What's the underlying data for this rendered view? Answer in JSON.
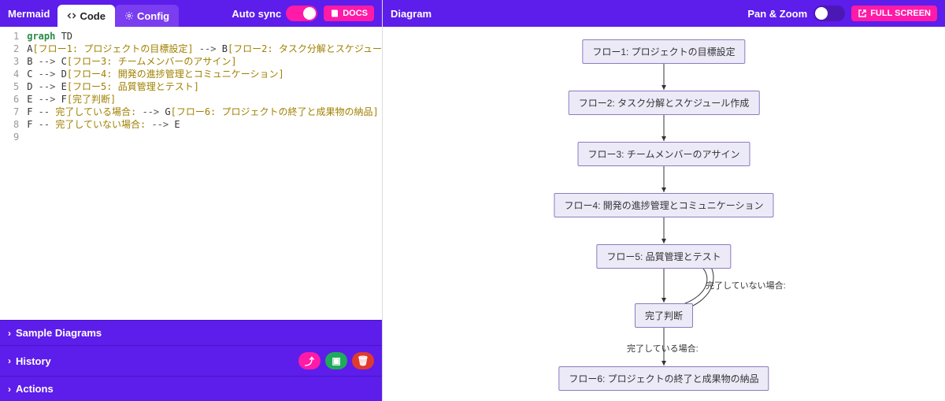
{
  "left": {
    "brand": "Mermaid",
    "tabs": {
      "code": "Code",
      "config": "Config"
    },
    "autosync_label": "Auto sync",
    "docs_label": "DOCS",
    "code": {
      "lines": [
        "1",
        "2",
        "3",
        "4",
        "5",
        "6",
        "7",
        "8",
        "9"
      ],
      "l1_kw": "graph",
      "l1_dir": "TD",
      "l2_a": "A",
      "l2_astr": "[フロー1: プロジェクトの目標設定]",
      "l2_arrow": " --> ",
      "l2_b": "B",
      "l2_bstr": "[フロー2: タスク分解とスケジュー",
      "l3_a": "B",
      "l3_arrow": " --> ",
      "l3_b": "C",
      "l3_bstr": "[フロー3: チームメンバーのアサイン]",
      "l4_a": "C",
      "l4_arrow": " --> ",
      "l4_b": "D",
      "l4_bstr": "[フロー4: 開発の進捗管理とコミュニケーション]",
      "l5_a": "D",
      "l5_arrow": " --> ",
      "l5_b": "E",
      "l5_bstr": "[フロー5: 品質管理とテスト]",
      "l6_a": "E",
      "l6_arrow": " --> ",
      "l6_b": "F",
      "l6_bstr": "[完了判断]",
      "l7_a": "F",
      "l7_dash": " -- ",
      "l7_lbl": "完了している場合:",
      "l7_arrow": " --> ",
      "l7_b": "G",
      "l7_bstr": "[フロー6: プロジェクトの終了と成果物の納品]",
      "l8_a": "F",
      "l8_dash": " -- ",
      "l8_lbl": "完了していない場合:",
      "l8_arrow": " --> ",
      "l8_b": "E"
    },
    "panels": {
      "sample": "Sample Diagrams",
      "history": "History",
      "actions": "Actions"
    }
  },
  "right": {
    "title": "Diagram",
    "panzoom": "Pan & Zoom",
    "fullscreen": "FULL SCREEN",
    "nodes": {
      "n1": "フロー1: プロジェクトの目標設定",
      "n2": "フロー2: タスク分解とスケジュール作成",
      "n3": "フロー3: チームメンバーのアサイン",
      "n4": "フロー4: 開発の進捗管理とコミュニケーション",
      "n5": "フロー5: 品質管理とテスト",
      "n6": "完了判断",
      "n7": "フロー6: プロジェクトの終了と成果物の納品"
    },
    "edge_labels": {
      "not_done": "完了していない場合:",
      "done": "完了している場合:"
    }
  }
}
